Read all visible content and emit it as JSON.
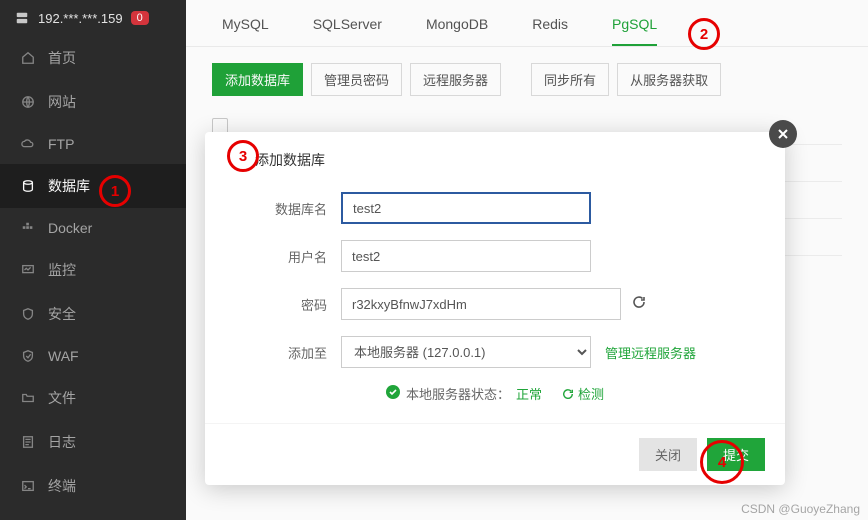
{
  "sidebar": {
    "host": "192.***.***.159",
    "badge": "0",
    "items": [
      {
        "label": "首页",
        "icon": "home"
      },
      {
        "label": "网站",
        "icon": "globe"
      },
      {
        "label": "FTP",
        "icon": "cloud"
      },
      {
        "label": "数据库",
        "icon": "database"
      },
      {
        "label": "Docker",
        "icon": "docker"
      },
      {
        "label": "监控",
        "icon": "monitor"
      },
      {
        "label": "安全",
        "icon": "shield"
      },
      {
        "label": "WAF",
        "icon": "waf"
      },
      {
        "label": "文件",
        "icon": "folder"
      },
      {
        "label": "日志",
        "icon": "log"
      },
      {
        "label": "终端",
        "icon": "terminal"
      }
    ]
  },
  "tabs": [
    {
      "label": "MySQL"
    },
    {
      "label": "SQLServer"
    },
    {
      "label": "MongoDB"
    },
    {
      "label": "Redis"
    },
    {
      "label": "PgSQL"
    }
  ],
  "toolbar": {
    "add_db": "添加数据库",
    "admin_pwd": "管理员密码",
    "remote_srv": "远程服务器",
    "sync_all": "同步所有",
    "get_from_srv": "从服务器获取"
  },
  "modal": {
    "title": "添加数据库",
    "labels": {
      "db_name": "数据库名",
      "username": "用户名",
      "password": "密码",
      "add_to": "添加至"
    },
    "values": {
      "db_name": "test2",
      "username": "test2",
      "password": "r32kxyBfnwJ7xdHm",
      "add_to_selected": "本地服务器 (127.0.0.1)"
    },
    "manage_remote": "管理远程服务器",
    "status_label": "本地服务器状态：",
    "status_value": "正常",
    "detect": "检测",
    "close_btn": "关闭",
    "submit_btn": "提交"
  },
  "annotations": {
    "a1": "1",
    "a2": "2",
    "a3": "3",
    "a4": "4"
  },
  "watermark": "CSDN @GuoyeZhang"
}
